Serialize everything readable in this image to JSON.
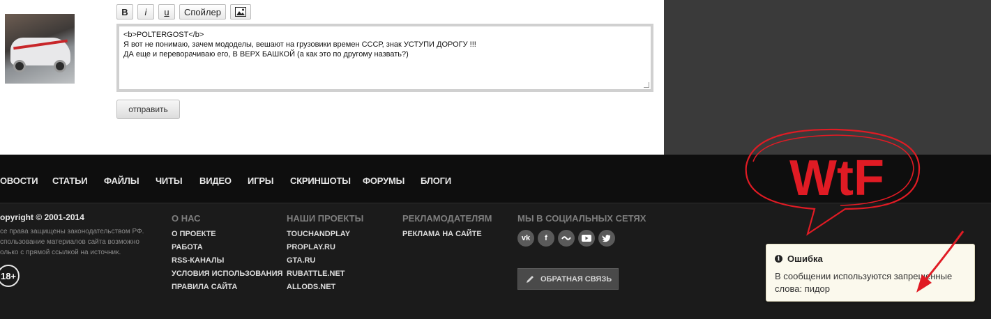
{
  "toolbar": {
    "bold_label": "B",
    "italic_label": "i",
    "underline_label": "u",
    "spoiler_label": "Спойлер"
  },
  "editor": {
    "lines": [
      "<b>POLTERGOST</b>",
      "Я вот не понимаю, зачем мододелы, вешают на грузовики времен СССР, знак УСТУПИ ДОРОГУ !!!",
      "ДА еще и переворачиваю его, В ВЕРХ БАШКОЙ (а как это по другому назвать?)"
    ]
  },
  "submit_label": "отправить",
  "nav": [
    "ОВОСТИ",
    "СТАТЬИ",
    "ФАЙЛЫ",
    "ЧИТЫ",
    "ВИДЕО",
    "ИГРЫ",
    "СКРИНШОТЫ",
    "ФОРУМЫ",
    "БЛОГИ"
  ],
  "footer": {
    "copyright": "opyright © 2001-2014",
    "rights": [
      "се права защищены законодательством РФ.",
      "спользование материалов сайта возможно",
      "олько с прямой ссылкой на источник."
    ],
    "age": "18+",
    "about": {
      "heading": "О НАС",
      "links": [
        "О ПРОЕКТЕ",
        "РАБОТА",
        "RSS-КАНАЛЫ",
        "УСЛОВИЯ ИСПОЛЬЗОВАНИЯ",
        "ПРАВИЛА САЙТА"
      ]
    },
    "projects": {
      "heading": "НАШИ ПРОЕКТЫ",
      "links": [
        "TOUCHANDPLAY",
        "PROPLAY.RU",
        "GTA.RU",
        "RUBATTLE.NET",
        "ALLODS.NET"
      ]
    },
    "advertisers": {
      "heading": "РЕКЛАМОДАТЕЛЯМ",
      "links": [
        "РЕКЛАМА НА САЙТЕ"
      ]
    },
    "social": {
      "heading": "МЫ В СОЦИАЛЬНЫХ СЕТЯХ",
      "icons": [
        "vk-icon",
        "facebook-icon",
        "moi-mir-icon",
        "youtube-icon",
        "twitter-icon"
      ]
    },
    "feedback_label": "ОБРАТНАЯ СВЯЗЬ"
  },
  "toast": {
    "title": "Ошибка",
    "message": "В сообщении используются запрещенные слова: пидор"
  },
  "annotation": {
    "text": "WtF",
    "color": "#e01b24"
  }
}
